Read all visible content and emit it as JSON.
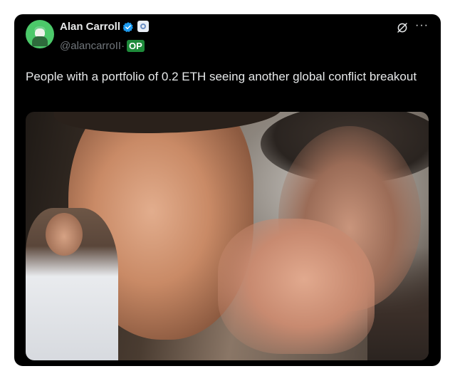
{
  "tweet": {
    "author_name": "Alan Carroll",
    "handle": "@alancarroII",
    "separator": "·",
    "op_badge": "OP",
    "text": "People with a portfolio of 0.2 ETH seeing another global conflict breakout",
    "media_alt": ""
  },
  "icons": {
    "avatar": "avatar",
    "verified": "verified-badge-icon",
    "affiliation": "affiliation-badge-icon",
    "grok": "grok-icon",
    "more": "more-icon"
  },
  "colors": {
    "card_background": "#000000",
    "text_primary": "#e7e9ea",
    "text_secondary": "#71767b",
    "verified_blue": "#1d9bf0",
    "op_green": "#1e8a3a",
    "avatar_green": "#4cc96a"
  }
}
